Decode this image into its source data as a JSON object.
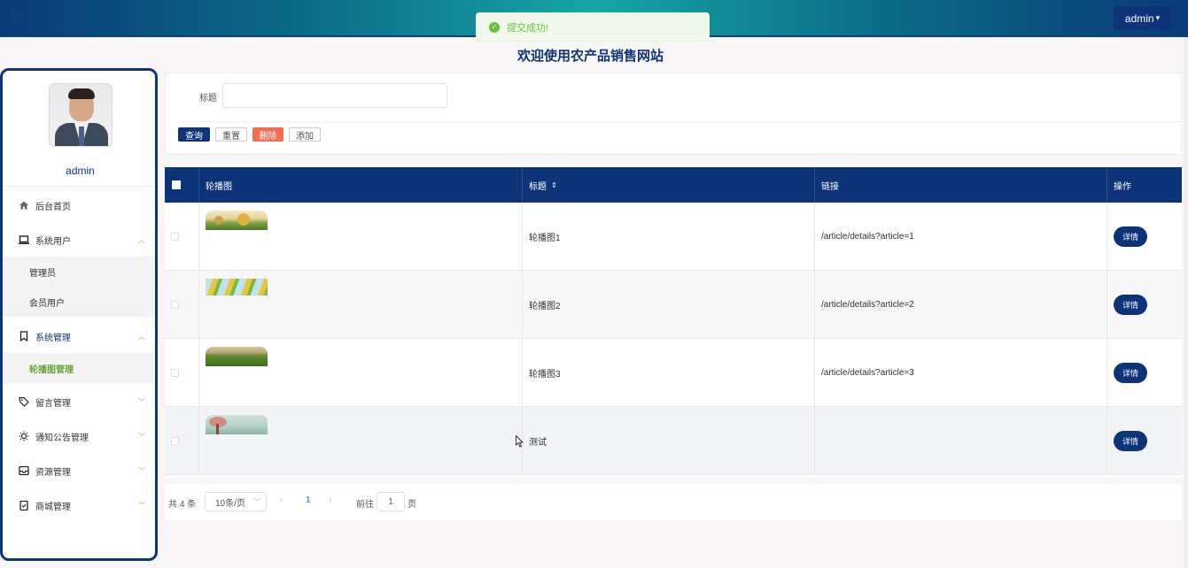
{
  "header": {
    "user_menu_label": "admin",
    "toast_message": "提交成功!",
    "page_title": "欢迎使用农产品销售网站",
    "colors": {
      "primary": "#0d3478",
      "success": "#67c23a",
      "danger": "#f56c52"
    }
  },
  "sidebar": {
    "user_name": "admin",
    "items": [
      {
        "label": "后台首页",
        "icon": "home-icon"
      },
      {
        "label": "系统用户",
        "icon": "laptop-icon",
        "expanded": true,
        "children": [
          "管理员",
          "会员用户"
        ]
      },
      {
        "label": "系统管理",
        "icon": "bookmark-icon",
        "expanded": true,
        "children": [
          "轮播图管理"
        ]
      },
      {
        "label": "留言管理",
        "icon": "tag-icon"
      },
      {
        "label": "通知公告管理",
        "icon": "sun-icon"
      },
      {
        "label": "资源管理",
        "icon": "inbox-icon"
      },
      {
        "label": "商城管理",
        "icon": "clipboard-check-icon"
      }
    ],
    "active_item": "轮播图管理"
  },
  "search": {
    "title_label": "标题",
    "title_value": "",
    "buttons": {
      "query": "查询",
      "reset": "重置",
      "delete": "删除",
      "add": "添加"
    }
  },
  "table": {
    "columns": [
      "轮播图",
      "标题",
      "链接",
      "操作"
    ],
    "rows": [
      {
        "title": "轮播图1",
        "link": "/article/details?article=1",
        "action": "详情"
      },
      {
        "title": "轮播图2",
        "link": "/article/details?article=2",
        "action": "详情"
      },
      {
        "title": "轮播图3",
        "link": "/article/details?article=3",
        "action": "详情"
      },
      {
        "title": "测试",
        "link": "",
        "action": "详情"
      }
    ]
  },
  "pagination": {
    "total_text": "共 4 条",
    "page_size": "10条/页",
    "prev": "‹",
    "current_page": "1",
    "next": "›",
    "goto_label": "前往",
    "goto_value": "1",
    "page_unit": "页"
  }
}
